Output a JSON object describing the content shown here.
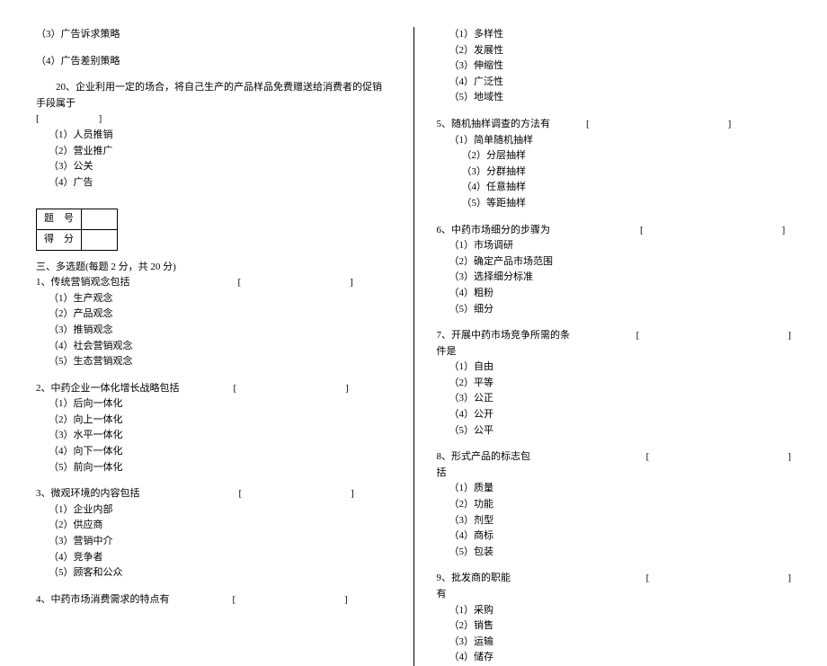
{
  "left": {
    "pre_items": [
      "（3）广告诉求策略",
      "（4）广告差别策略"
    ],
    "q20": {
      "text": "　　20、企业利用一定的场合，将自己生产的产品样品免费赠送给消费者的促销手段属于",
      "bracket": "[　　　　　　]",
      "options": [
        "（1）人员推销",
        "（2）营业推广",
        "（3）公关",
        "（4）广告"
      ]
    },
    "score_table": {
      "r1c1": "题　号",
      "r2c1": "得　分"
    },
    "section3_title": "三、多选题(每题 2 分，共 20 分)",
    "q1": {
      "text": "1、传统营销观念包括",
      "bracket": "[　　　　　　　　　　　]",
      "options": [
        "（1）生产观念",
        "（2）产品观念",
        "（3）推销观念",
        "（4）社会营销观念",
        "（5）生态营销观念"
      ]
    },
    "q2": {
      "text": "2、中药企业一体化增长战略包括",
      "bracket": "[　　　　　　　　　　　]",
      "options": [
        "（1）后向一体化",
        "（2）向上一体化",
        "（3）水平一体化",
        "（4）向下一体化",
        "（5）前向一体化"
      ]
    },
    "q3": {
      "text": "3、微观环境的内容包括",
      "bracket": "[　　　　　　　　　　　]",
      "options": [
        "（1）企业内部",
        "（2）供应商",
        "（3）营销中介",
        "（4）竞争者",
        "（5）顾客和公众"
      ]
    },
    "q4": {
      "text": "4、中药市场消费需求的特点有",
      "bracket": "[　　　　　　　　　　　]"
    }
  },
  "right": {
    "q4_options": [
      "（1）多样性",
      "（2）发展性",
      "（3）伸缩性",
      "（4）广泛性",
      "（5）地域性"
    ],
    "q5": {
      "text": "5、随机抽样调查的方法有",
      "bracket": "[　　　　　　　　　　　　　　]",
      "options": [
        "（1）简单随机抽样",
        "（2）分层抽样",
        "（3）分群抽样",
        "（4）任意抽样",
        "（5）等距抽样"
      ]
    },
    "q6": {
      "text": "6、中药市场细分的步骤为",
      "bracket": "[　　　　　　　　　　　　　　]",
      "options": [
        "（1）市场调研",
        "（2）确定产品市场范围",
        "（3）选择细分标准",
        "（4）粗粉",
        "（5）细分"
      ]
    },
    "q7": {
      "text": "7、开展中药市场竞争所需的条件是",
      "bracket": "[　　　　　　　　　　　　　　　]",
      "options": [
        "（1）自由",
        "（2）平等",
        "（3）公正",
        "（4）公开",
        "（5）公平"
      ]
    },
    "q8": {
      "text": "8、形式产品的标志包括",
      "bracket": "[　　　　　　　　　　　　　　]",
      "options": [
        "（1）质量",
        "（2）功能",
        "（3）剂型",
        "（4）商标",
        "（5）包装"
      ]
    },
    "q9": {
      "text": "9、批发商的职能有",
      "bracket": "[　　　　　　　　　　　　　　]",
      "options": [
        "（1）采购",
        "（2）销售",
        "（3）运输",
        "（4）储存"
      ]
    }
  }
}
